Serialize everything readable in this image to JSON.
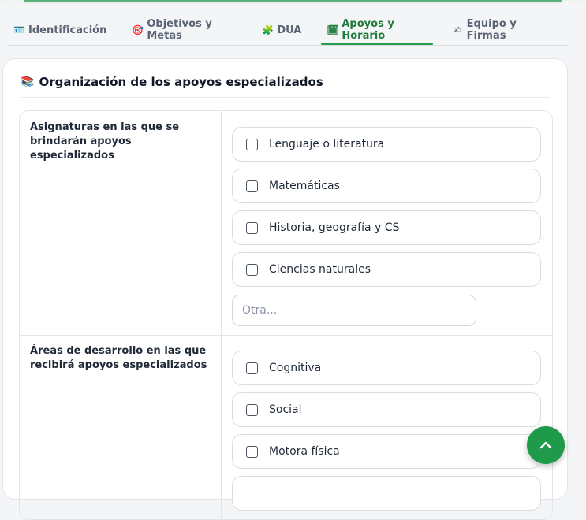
{
  "tabs": [
    {
      "label": "Identificación",
      "icon": "id-card-icon",
      "glyph": "🪪",
      "active": false
    },
    {
      "label": "Objetivos y Metas",
      "icon": "target-icon",
      "glyph": "🎯",
      "active": false
    },
    {
      "label": "DUA",
      "icon": "puzzle-icon",
      "glyph": "🧩",
      "active": false
    },
    {
      "label": "Apoyos y Horario",
      "icon": "calendar-icon",
      "glyph": "🗓",
      "active": true
    },
    {
      "label": "Equipo y Firmas",
      "icon": "writing-hand-icon",
      "glyph": "✍",
      "active": false
    }
  ],
  "section": {
    "title": "Organización de los apoyos especializados",
    "icon": "books-icon",
    "glyph": "📚"
  },
  "subjects": {
    "label": "Asignaturas en las que se brindarán apoyos especializados",
    "options": [
      "Lenguaje o literatura",
      "Matemáticas",
      "Historia, geografía y CS",
      "Ciencias naturales"
    ],
    "other_placeholder": "Otra..."
  },
  "areas": {
    "label": "Áreas de desarrollo en las que recibirá apoyos especializados",
    "options": [
      "Cognitiva",
      "Social",
      "Motora física"
    ]
  },
  "scroll_top_button": {
    "icon": "chevron-up-icon"
  },
  "colors": {
    "accent": "#1f9a4a",
    "active_tab": "#1f7a3c"
  }
}
